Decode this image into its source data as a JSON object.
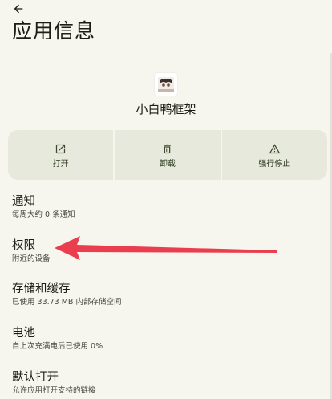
{
  "header": {
    "back_icon": "arrow-left-icon",
    "title": "应用信息"
  },
  "app": {
    "icon": "app-avatar-icon",
    "name": "小白鸭框架"
  },
  "actions": [
    {
      "label": "打开",
      "icon": "open-in-new-icon"
    },
    {
      "label": "卸载",
      "icon": "trash-icon"
    },
    {
      "label": "强行停止",
      "icon": "warning-icon"
    }
  ],
  "settings": [
    {
      "title": "通知",
      "subtitle": "每周大约 0 条通知"
    },
    {
      "title": "权限",
      "subtitle": "附近的设备"
    },
    {
      "title": "存储和缓存",
      "subtitle": "已使用 33.73 MB 内部存储空间"
    },
    {
      "title": "电池",
      "subtitle": "自上次充满电后已使用 0%"
    },
    {
      "title": "默认打开",
      "subtitle": "允许应用打开支持的链接"
    }
  ],
  "colors": {
    "background": "#f6f5ee",
    "action_tile": "#e8e9dd",
    "icon_tint": "#3b4a2c",
    "annotation_arrow": "#ea3e4f"
  }
}
